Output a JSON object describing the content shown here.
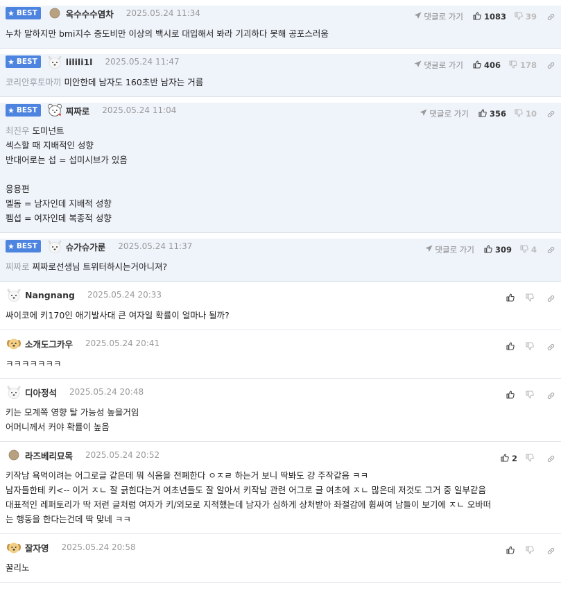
{
  "labels": {
    "best": "BEST",
    "goto": "댓글로 가기"
  },
  "comments": [
    {
      "best": true,
      "avatar": "dot",
      "nick": "옥수수수염차",
      "date": "2025.05.24 11:34",
      "likes": "1083",
      "dislikes": "39",
      "mention": "",
      "lines": [
        "누차 말하지만 bmi지수 중도비만 이상의 백시로 대입해서 봐라 기괴하다 못해 공포스러움"
      ]
    },
    {
      "best": true,
      "avatar": "dog-white",
      "nick": "lilili1l",
      "date": "2025.05.24 11:47",
      "likes": "406",
      "dislikes": "178",
      "mention": "코리안후토마끼",
      "lines": [
        "미안한데 남자도 160초반 남자는 거름"
      ]
    },
    {
      "best": true,
      "avatar": "bear",
      "nick": "찌짜로",
      "date": "2025.05.24 11:04",
      "likes": "356",
      "dislikes": "10",
      "mention": "최진우",
      "lines": [
        "도미넌트",
        "섹스할 때 지배적인 성향",
        "반대어로는 섭 = 섭미시브가 있음",
        "",
        "응용편",
        "멜돔 = 남자인데 지배적 성향",
        "펨섭 = 여자인데 복종적 성향"
      ]
    },
    {
      "best": true,
      "avatar": "dog-white",
      "nick": "슈가슈가룬",
      "date": "2025.05.24 11:37",
      "likes": "309",
      "dislikes": "4",
      "mention": "찌짜로",
      "lines": [
        "찌짜로선생님 트위터하시는거아니져?"
      ]
    },
    {
      "best": false,
      "avatar": "dog-white",
      "nick": "Nangnang",
      "date": "2025.05.24 20:33",
      "likes": "",
      "dislikes": "",
      "mention": "",
      "lines": [
        "싸이코에 키170인 애기발사대 큰 여자일 확률이 얼마나 될까?"
      ]
    },
    {
      "best": false,
      "avatar": "dog-yellow",
      "nick": "소개도그카우",
      "date": "2025.05.24 20:41",
      "likes": "",
      "dislikes": "",
      "mention": "",
      "lines": [
        "ㅋㅋㅋㅋㅋㅋㅋ"
      ]
    },
    {
      "best": false,
      "avatar": "dog-white",
      "nick": "디아정석",
      "date": "2025.05.24 20:48",
      "likes": "",
      "dislikes": "",
      "mention": "",
      "lines": [
        "키는 모계쪽 영향 탈 가능성 높을거임",
        "어머니께서 커야 확률이 높음"
      ]
    },
    {
      "best": false,
      "avatar": "dot",
      "nick": "라즈베리묘목",
      "date": "2025.05.24 20:52",
      "likes": "2",
      "dislikes": "",
      "mention": "",
      "lines": [
        "키작남 욕먹이려는 어그로글 같은데 뭐 식음을 전폐한다 ㅇㅈㄹ 하는거 보니 딱봐도 걍 주작같음 ㅋㅋ",
        "남자들한테 키<-- 이거 ㅈㄴ 잘 긁힌다는거 여초년들도 잘 알아서 키작남 관련 어그로 글 여초에 ㅈㄴ 많은데 저것도 그거 중 일부같음",
        "대표적인 레퍼토리가 딱 저런 글처럼 여자가 키/외모로 지적했는데 남자가 심하게 상처받아 좌절감에 휩싸여 남들이 보기에 ㅈㄴ 오바떠",
        "는 행동을 한다는건데 딱 맞네 ㅋㅋ"
      ]
    },
    {
      "best": false,
      "avatar": "dog-yellow",
      "nick": "잘자영",
      "date": "2025.05.24 20:58",
      "likes": "",
      "dislikes": "",
      "mention": "",
      "lines": [
        "꿀리노"
      ]
    }
  ]
}
